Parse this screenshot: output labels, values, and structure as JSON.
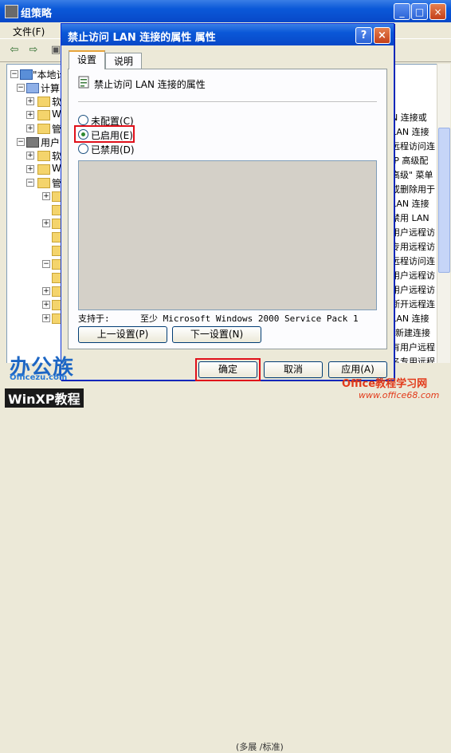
{
  "background_window": {
    "title": "组策略",
    "menu": [
      "文件(F)"
    ],
    "tree": [
      {
        "label": "\"本地计",
        "exp": "−"
      },
      {
        "label": "计算",
        "exp": "−"
      },
      {
        "label": "软",
        "exp": "+"
      },
      {
        "label": "W",
        "exp": "+"
      },
      {
        "label": "管",
        "exp": "+"
      },
      {
        "label": "用户",
        "exp": "−"
      },
      {
        "label": "软",
        "exp": "+"
      },
      {
        "label": "W",
        "exp": "+"
      },
      {
        "label": "管",
        "exp": "−"
      }
    ],
    "list_items": [
      "N 连接或",
      "LAN 连接",
      "远程访问连",
      "IP 高级配",
      "高级\" 菜单",
      "或删除用于",
      "LAN 连接",
      "禁用 LAN",
      "用户远程访",
      "专用远程访",
      "远程访问连",
      "用户远程访",
      "用户远程访",
      "断开远程连",
      "LAN 连接",
      "\"新建连接",
      "有用户远程",
      "名专用远程",
      "有用户远程"
    ],
    "status_text": "(多展 /标准)"
  },
  "dialog": {
    "title": "禁止访问 LAN 连接的属性 属性",
    "help_button": "?",
    "close_button": "×",
    "tabs": [
      {
        "label": "设置",
        "active": true
      },
      {
        "label": "说明",
        "active": false
      }
    ],
    "policy_name": "禁止访问 LAN 连接的属性",
    "options": [
      {
        "label": "未配置(C)",
        "checked": false
      },
      {
        "label": "已启用(E)",
        "checked": true
      },
      {
        "label": "已禁用(D)",
        "checked": false
      }
    ],
    "supported_label": "支持于:",
    "supported_value": "至少 Microsoft Windows 2000 Service Pack 1",
    "prev_button": "上一设置(P)",
    "next_button": "下一设置(N)",
    "ok_button": "确定",
    "cancel_button": "取消",
    "apply_button": "应用(A)"
  },
  "watermarks": {
    "logo1": "办公族",
    "logo1_sub": "Officezu.com",
    "logo2": "WinXP教程",
    "logo3": "Office教程学习网",
    "logo3_url": "www.office68.com"
  },
  "colors": {
    "titlebar": "#0A58D8",
    "highlight": "#e0101a",
    "window_bg": "#ECE9D8"
  }
}
